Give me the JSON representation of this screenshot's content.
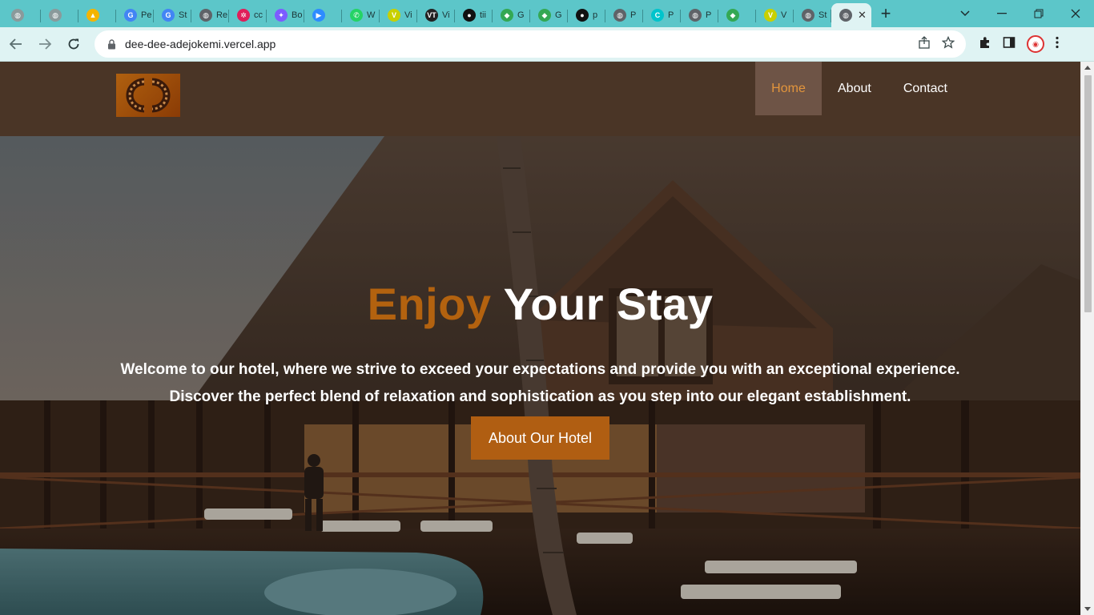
{
  "browser": {
    "tabs": [
      {
        "icon": "globe-icon",
        "title": "",
        "color": "#8a9a9b"
      },
      {
        "icon": "globe-icon",
        "title": "",
        "color": "#8a9a9b"
      },
      {
        "icon": "drive-icon",
        "title": "",
        "color": "#f4b400"
      },
      {
        "icon": "google-icon",
        "title": "Pe",
        "color": "#4285f4"
      },
      {
        "icon": "google-icon",
        "title": "St",
        "color": "#4285f4"
      },
      {
        "icon": "globe-icon",
        "title": "Re",
        "color": "#5f6368"
      },
      {
        "icon": "slack-icon",
        "title": "cc",
        "color": "#e01e5a"
      },
      {
        "icon": "sparkle-icon",
        "title": "Bo",
        "color": "#7c5cff"
      },
      {
        "icon": "zoom-icon",
        "title": "",
        "color": "#2d8cff"
      },
      {
        "icon": "whatsapp-icon",
        "title": "W",
        "color": "#25d366"
      },
      {
        "icon": "vercel-v-icon",
        "title": "Vi",
        "color": "#c8d000"
      },
      {
        "icon": "vt-icon",
        "title": "Vi",
        "color": "#222222"
      },
      {
        "icon": "github-icon",
        "title": "tii",
        "color": "#111111"
      },
      {
        "icon": "maps-icon",
        "title": "G",
        "color": "#34a853"
      },
      {
        "icon": "maps-icon",
        "title": "G",
        "color": "#34a853"
      },
      {
        "icon": "github-icon",
        "title": "p",
        "color": "#111111"
      },
      {
        "icon": "globe-icon",
        "title": "P",
        "color": "#5f6368"
      },
      {
        "icon": "canva-icon",
        "title": "P",
        "color": "#00c4cc"
      },
      {
        "icon": "globe-icon",
        "title": "P",
        "color": "#5f6368"
      },
      {
        "icon": "maps-icon",
        "title": "",
        "color": "#34a853"
      },
      {
        "icon": "vercel-v-icon",
        "title": "V",
        "color": "#c8d000"
      },
      {
        "icon": "globe-icon",
        "title": "St",
        "color": "#5f6368"
      }
    ],
    "active_tab_icon": "globe-icon",
    "url": "dee-dee-adejokemi.vercel.app",
    "accent": "#5cc6c9"
  },
  "site": {
    "nav": {
      "items": [
        {
          "label": "Home",
          "active": true
        },
        {
          "label": "About",
          "active": false
        },
        {
          "label": "Contact",
          "active": false
        }
      ],
      "background": "#4a3526",
      "active_color": "#e3953c"
    },
    "hero": {
      "headline_accent": "Enjoy",
      "headline_rest": "Your Stay",
      "tagline_line1": "Welcome to our hotel, where we strive to exceed your expectations and provide you with an exceptional experience.",
      "tagline_line2": "Discover the perfect blend of relaxation and sophistication as you step into our elegant establishment.",
      "cta_label": "About Our Hotel",
      "accent": "#b3620f"
    }
  }
}
